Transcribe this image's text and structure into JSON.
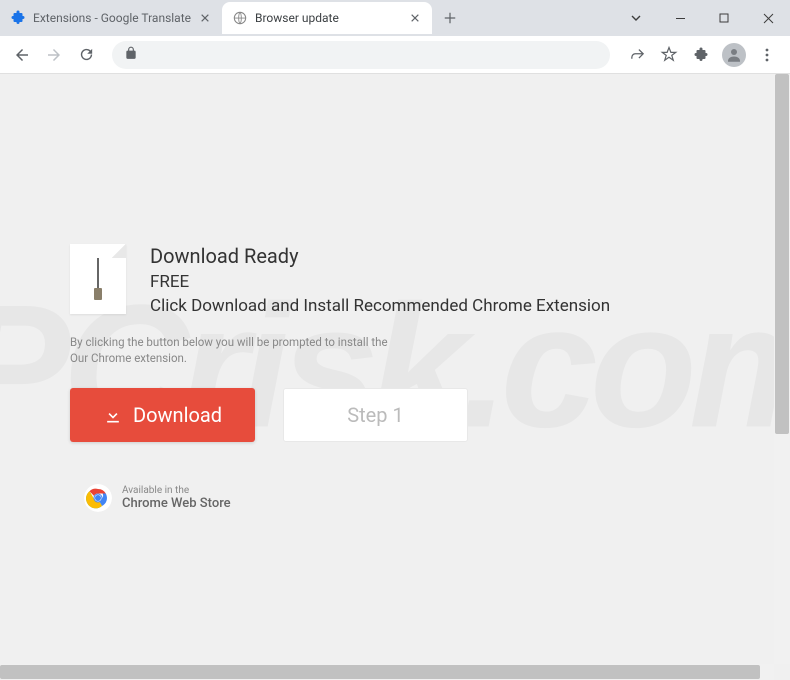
{
  "tabs": [
    {
      "title": "Extensions - Google Translate",
      "favicon": "puzzle-icon",
      "active": false
    },
    {
      "title": "Browser update",
      "favicon": "globe-icon",
      "active": true
    }
  ],
  "window_controls": {
    "caret": "⌄",
    "minimize": "—",
    "maximize": "▢",
    "close": "✕"
  },
  "content": {
    "heading": "Download Ready",
    "free_label": "FREE",
    "subtitle": "Click Download and Install Recommended Chrome Extension",
    "disclaimer_line1": "By clicking the button below you will be prompted to install the",
    "disclaimer_line2": "Our Chrome extension.",
    "download_label": "Download",
    "step_label": "Step 1",
    "webstore_line1": "Available in the",
    "webstore_line2": "Chrome Web Store"
  },
  "watermark": "PCrisk.com"
}
